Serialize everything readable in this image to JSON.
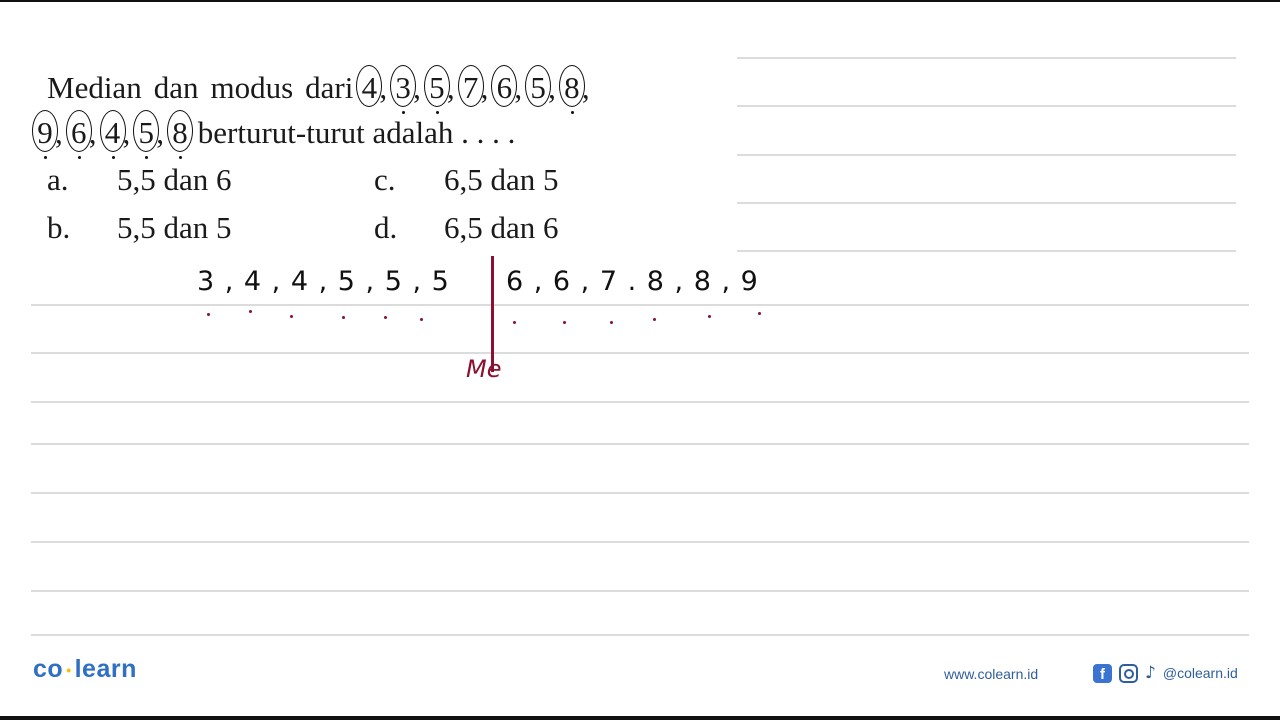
{
  "question": {
    "intro": [
      "Median",
      "dan",
      "modus",
      "dari"
    ],
    "data_line1": [
      "4",
      "3",
      "5",
      "7",
      "6",
      "5",
      "8"
    ],
    "data_line2": [
      "9",
      "6",
      "4",
      "5",
      "8"
    ],
    "outro": "berturut-turut adalah . . . ."
  },
  "options": [
    {
      "letter": "a.",
      "text": "5,5 dan 6"
    },
    {
      "letter": "b.",
      "text": "5,5 dan 5"
    },
    {
      "letter": "c.",
      "text": "6,5 dan 5"
    },
    {
      "letter": "d.",
      "text": "6,5 dan 6"
    }
  ],
  "working": {
    "sorted_left": "3 , 4 , 4 , 5 , 5 , 5",
    "sorted_right": "6 , 6 , 7 . 8 , 8 , 9",
    "median_label": "Me",
    "ink_color": "#8a1230"
  },
  "footer": {
    "logo_left": "co",
    "logo_sep": "•",
    "logo_right": "learn",
    "website": "www.colearn.id",
    "facebook_glyph": "f",
    "tiktok_glyph": "♪",
    "handle": "@colearn.id"
  }
}
